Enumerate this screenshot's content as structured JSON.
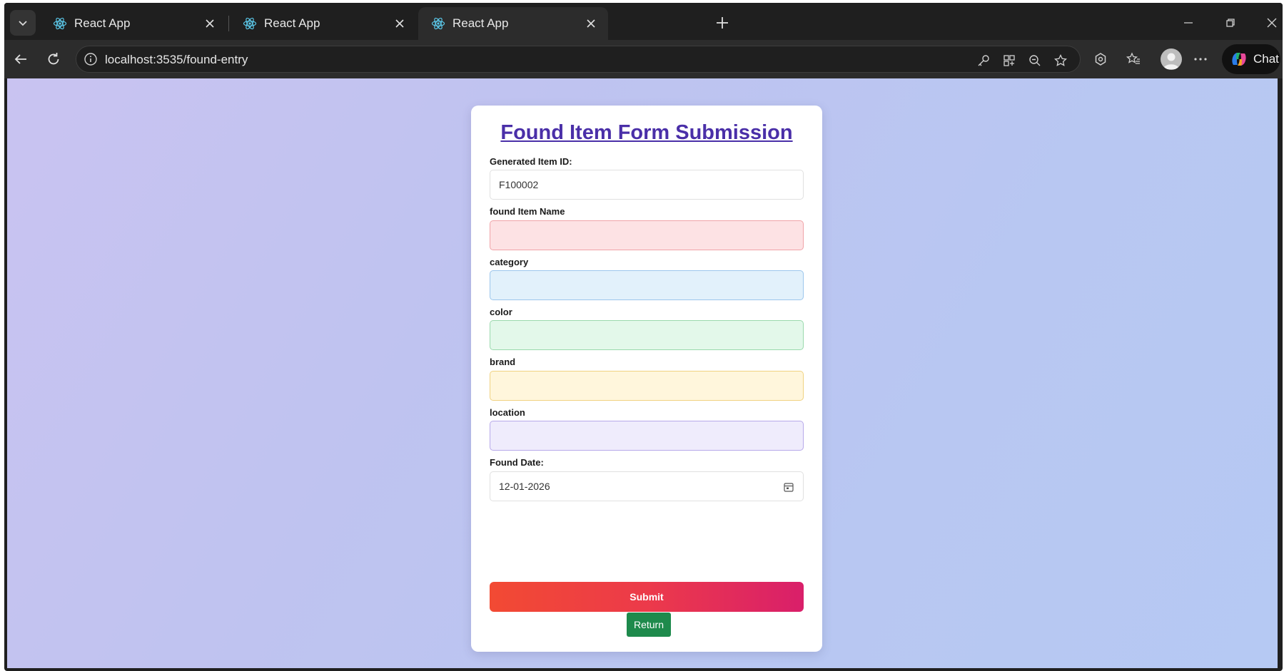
{
  "browser": {
    "tabs": [
      {
        "title": "React App"
      },
      {
        "title": "React App"
      },
      {
        "title": "React App"
      }
    ],
    "url": "localhost:3535/found-entry",
    "chat_label": "Chat"
  },
  "form": {
    "title": "Found Item Form Submission",
    "fields": {
      "item_id": {
        "label": "Generated Item ID:",
        "value": "F100002"
      },
      "name": {
        "label": "found Item Name",
        "value": ""
      },
      "category": {
        "label": "category",
        "value": ""
      },
      "color": {
        "label": "color",
        "value": ""
      },
      "brand": {
        "label": "brand",
        "value": ""
      },
      "location": {
        "label": "location",
        "value": ""
      },
      "found_date": {
        "label": "Found Date:",
        "value": "12-01-2026"
      }
    },
    "submit_label": "Submit",
    "return_label": "Return"
  },
  "colors": {
    "title": "#4a2fa8",
    "submit_start": "#f24a33",
    "submit_end": "#d91f6a",
    "return": "#1e8a4c"
  },
  "icons": {
    "tab_menu": "chevron-down-icon",
    "favicon": "react-icon",
    "close": "close-icon",
    "new_tab": "plus-icon",
    "calendar": "calendar-icon"
  }
}
